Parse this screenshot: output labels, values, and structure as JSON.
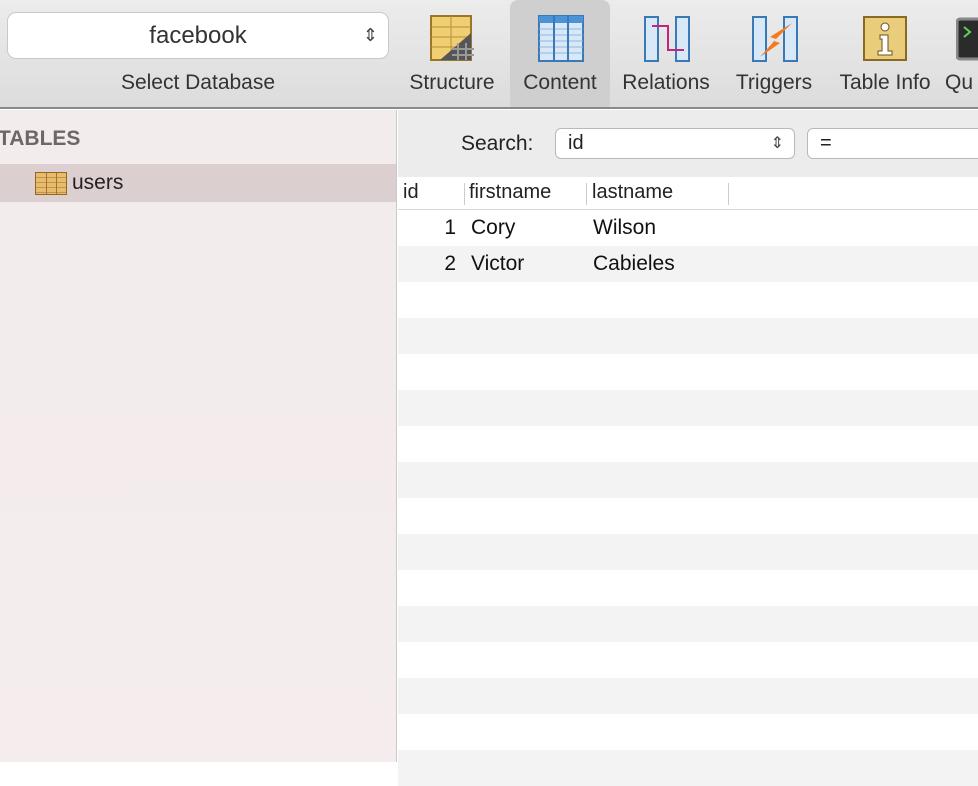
{
  "toolbar": {
    "database": "facebook",
    "database_label": "Select Database",
    "items": [
      {
        "label": "Structure",
        "icon": "structure-icon"
      },
      {
        "label": "Content",
        "icon": "content-icon",
        "selected": true
      },
      {
        "label": "Relations",
        "icon": "relations-icon"
      },
      {
        "label": "Triggers",
        "icon": "triggers-icon"
      },
      {
        "label": "Table Info",
        "icon": "table-info-icon"
      },
      {
        "label": "Qu",
        "icon": "query-icon"
      }
    ]
  },
  "sidebar": {
    "heading": "TABLES",
    "tables": [
      {
        "name": "users",
        "selected": true
      }
    ]
  },
  "search": {
    "label": "Search:",
    "field": "id",
    "operator": "="
  },
  "table": {
    "columns": [
      "id",
      "firstname",
      "lastname"
    ],
    "rows": [
      [
        "1",
        "Cory",
        "Wilson"
      ],
      [
        "2",
        "Victor",
        "Cabieles"
      ]
    ]
  }
}
